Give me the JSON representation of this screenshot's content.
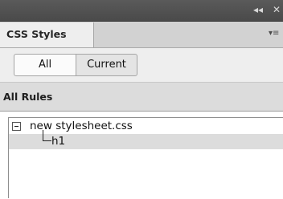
{
  "titlebar": {
    "collapse_glyph": "◂◂",
    "close_glyph": "✕"
  },
  "tabs": [
    {
      "label": "CSS Styles",
      "active": true
    }
  ],
  "panel_menu_glyph": "▾≡",
  "mode": {
    "options": [
      "All",
      "Current"
    ],
    "selected": "All"
  },
  "section": {
    "title": "All Rules"
  },
  "rules": {
    "stylesheet": "new stylesheet.css",
    "selectors": [
      "h1"
    ]
  }
}
